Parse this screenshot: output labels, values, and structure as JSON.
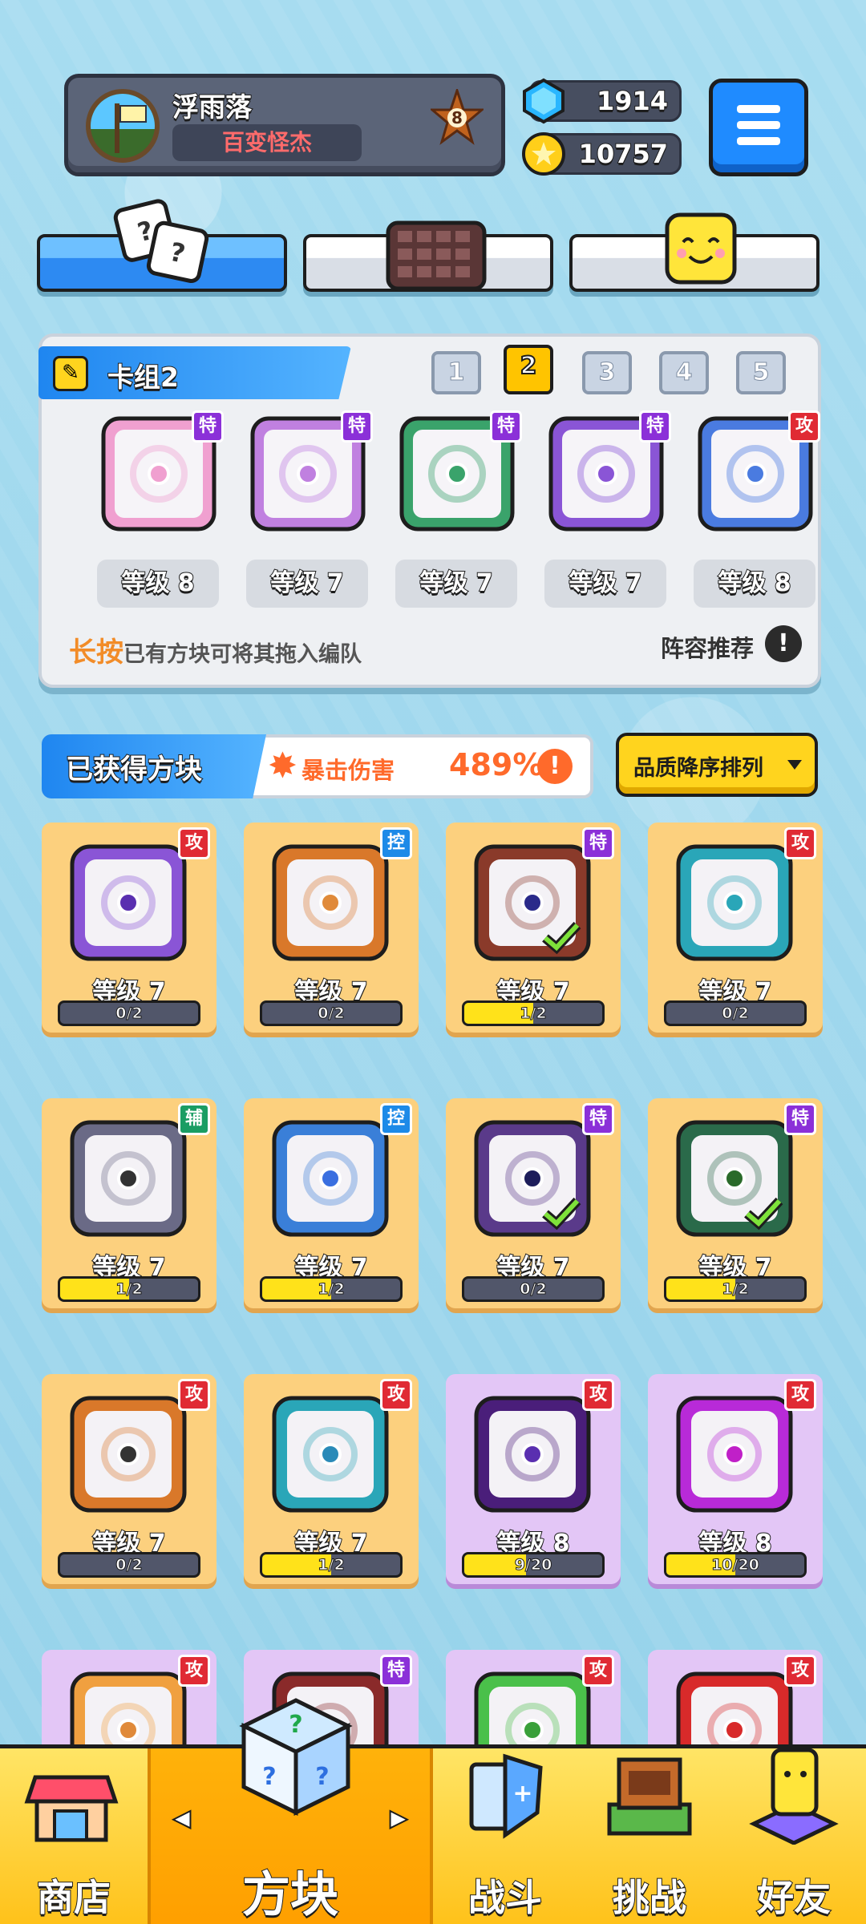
{
  "header": {
    "player_name": "浮雨落",
    "player_title": "百变怪杰",
    "rank_level": "8",
    "gems": "1914",
    "coins": "10757"
  },
  "top_tabs": [
    {
      "name": "dice",
      "icon": "dice-icon",
      "active": true
    },
    {
      "name": "board",
      "icon": "grid-board-icon",
      "active": false
    },
    {
      "name": "emote",
      "icon": "smiley-block-icon",
      "active": false
    }
  ],
  "deck": {
    "title": "卡组2",
    "tabs": [
      "1",
      "2",
      "3",
      "4",
      "5"
    ],
    "active_tab": "2",
    "cards": [
      {
        "type": "特",
        "level": "等级 8",
        "color": "#f0a0d0"
      },
      {
        "type": "特",
        "level": "等级 7",
        "color": "#c080e0"
      },
      {
        "type": "特",
        "level": "等级 7",
        "color": "#3aa36b"
      },
      {
        "type": "特",
        "level": "等级 7",
        "color": "#8a55d6"
      },
      {
        "type": "攻",
        "level": "等级 8",
        "color": "#4a7be0"
      }
    ],
    "hint_emph": "长按",
    "hint_text": "已有方块可将其拖入编队",
    "recommend": "阵容推荐",
    "info_glyph": "!"
  },
  "owned": {
    "title": "已获得方块",
    "crit_label": "暴击伤害",
    "crit_value": "489%",
    "info_glyph": "!",
    "sort_label": "品质降序排列",
    "cards": [
      {
        "type": "攻",
        "level": "等级 7",
        "progress": "0/2",
        "fill": 0,
        "frame": "#8a55d6",
        "dot": "#5a2fb0",
        "card": "gold"
      },
      {
        "type": "控",
        "level": "等级 7",
        "progress": "0/2",
        "fill": 0,
        "frame": "#d9782a",
        "dot": "#e08a3a",
        "card": "gold"
      },
      {
        "type": "特",
        "level": "等级 7",
        "progress": "1/2",
        "fill": 0.5,
        "frame": "#8a3a2a",
        "dot": "#2a2a8a",
        "card": "gold",
        "check": true
      },
      {
        "type": "攻",
        "level": "等级 7",
        "progress": "0/2",
        "fill": 0,
        "frame": "#2aa6b8",
        "dot": "#2aa6b8",
        "card": "gold"
      },
      {
        "type": "辅",
        "level": "等级 7",
        "progress": "1/2",
        "fill": 0.5,
        "frame": "#6a6a86",
        "dot": "#333",
        "card": "gold"
      },
      {
        "type": "控",
        "level": "等级 7",
        "progress": "1/2",
        "fill": 0.5,
        "frame": "#3a7fd8",
        "dot": "#3a6fe0",
        "card": "gold"
      },
      {
        "type": "特",
        "level": "等级 7",
        "progress": "0/2",
        "fill": 0,
        "frame": "#5a3a8a",
        "dot": "#1d1d5a",
        "card": "gold",
        "check": true
      },
      {
        "type": "特",
        "level": "等级 7",
        "progress": "1/2",
        "fill": 0.5,
        "frame": "#2a6a4a",
        "dot": "#2a6a2a",
        "card": "gold",
        "check": true
      },
      {
        "type": "攻",
        "level": "等级 7",
        "progress": "0/2",
        "fill": 0,
        "frame": "#d9782a",
        "dot": "#333",
        "card": "gold"
      },
      {
        "type": "攻",
        "level": "等级 7",
        "progress": "1/2",
        "fill": 0.5,
        "frame": "#2aa6b8",
        "dot": "#2a8ab8",
        "card": "gold"
      },
      {
        "type": "攻",
        "level": "等级 8",
        "progress": "9/20",
        "fill": 0.45,
        "frame": "#4a1e7a",
        "dot": "#5a2fb0",
        "card": "purple"
      },
      {
        "type": "攻",
        "level": "等级 8",
        "progress": "10/20",
        "fill": 0.5,
        "frame": "#b82ad8",
        "dot": "#c020c8",
        "card": "purple"
      },
      {
        "type": "攻",
        "frame": "#f0a040",
        "dot": "#e08a3a",
        "card": "purple"
      },
      {
        "type": "特",
        "frame": "#8a2a2a",
        "dot": "#555",
        "card": "purple"
      },
      {
        "type": "攻",
        "frame": "#4ac04a",
        "dot": "#3aa03a",
        "card": "purple"
      },
      {
        "type": "攻",
        "frame": "#d82a2a",
        "dot": "#d82a2a",
        "card": "purple"
      }
    ]
  },
  "nav": {
    "items": [
      {
        "label": "商店",
        "icon": "shop-icon"
      },
      {
        "label": "方块",
        "icon": "dice-block-icon"
      },
      {
        "label": "战斗",
        "icon": "battle-icon"
      },
      {
        "label": "挑战",
        "icon": "challenge-icon"
      },
      {
        "label": "好友",
        "icon": "friends-icon"
      }
    ],
    "active": "方块",
    "prev_glyph": "◀",
    "next_glyph": "▶"
  },
  "colors": {
    "accent_blue": "#1f8bff",
    "gold": "#ffd41e",
    "crit": "#ff6a2b"
  }
}
